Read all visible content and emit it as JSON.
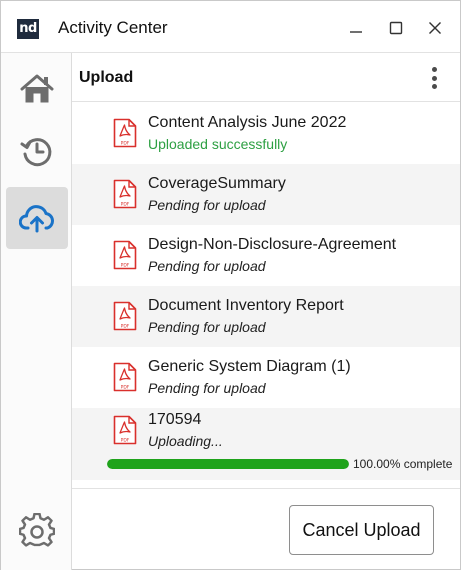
{
  "window": {
    "title": "Activity Center",
    "logo_text": "nd"
  },
  "rail": {
    "items": [
      {
        "name": "home",
        "icon": "home-icon",
        "active": false
      },
      {
        "name": "recent",
        "icon": "history-icon",
        "active": false
      },
      {
        "name": "upload",
        "icon": "cloud-upload-icon",
        "active": true
      }
    ],
    "settings_icon": "gear-icon"
  },
  "panel": {
    "title": "Upload",
    "menu_icon": "kebab-menu-icon"
  },
  "uploads": [
    {
      "name": "Content Analysis June 2022",
      "status": "Uploaded successfully"
    },
    {
      "name": "CoverageSummary",
      "status": "Pending for upload"
    },
    {
      "name": "Design-Non-Disclosure-Agreement",
      "status": "Pending for upload"
    },
    {
      "name": "Document Inventory Report",
      "status": "Pending for upload"
    },
    {
      "name": "Generic System Diagram (1)",
      "status": "Pending for upload"
    },
    {
      "name": "170594",
      "status": "Uploading...",
      "progress_percent": 100,
      "progress_text": "100.00% complete"
    }
  ],
  "file_icon_label": "PDF",
  "footer": {
    "cancel_label": "Cancel Upload"
  },
  "colors": {
    "accent": "#1a73c8",
    "success_text": "#2ea043",
    "progress": "#1fa31b",
    "pdf_red": "#d9302c",
    "logo_bg": "#1f2b3d"
  }
}
